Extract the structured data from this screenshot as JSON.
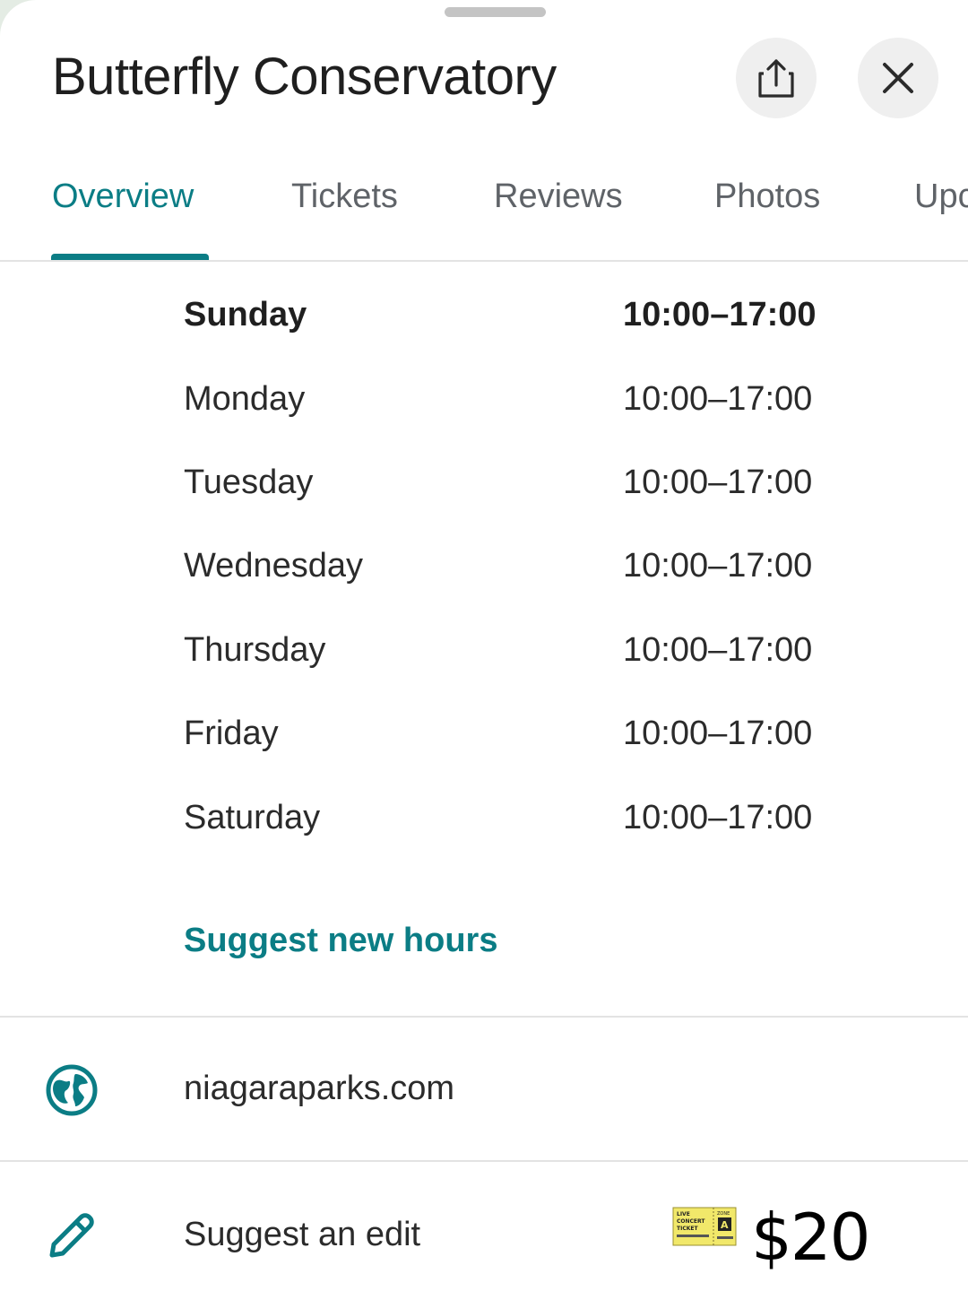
{
  "header": {
    "title": "Butterfly Conservatory",
    "share_icon": "share-icon",
    "close_icon": "close-icon"
  },
  "tabs": [
    {
      "label": "Overview",
      "active": true
    },
    {
      "label": "Tickets",
      "active": false
    },
    {
      "label": "Reviews",
      "active": false
    },
    {
      "label": "Photos",
      "active": false
    },
    {
      "label": "Upc",
      "active": false
    }
  ],
  "hours": [
    {
      "day": "Sunday",
      "time": "10:00–17:00",
      "today": true
    },
    {
      "day": "Monday",
      "time": "10:00–17:00",
      "today": false
    },
    {
      "day": "Tuesday",
      "time": "10:00–17:00",
      "today": false
    },
    {
      "day": "Wednesday",
      "time": "10:00–17:00",
      "today": false
    },
    {
      "day": "Thursday",
      "time": "10:00–17:00",
      "today": false
    },
    {
      "day": "Friday",
      "time": "10:00–17:00",
      "today": false
    },
    {
      "day": "Saturday",
      "time": "10:00–17:00",
      "today": false
    }
  ],
  "suggest_hours_label": "Suggest new hours",
  "website": {
    "icon": "globe-icon",
    "text": "niagaraparks.com"
  },
  "edit": {
    "icon": "pencil-icon",
    "text": "Suggest an edit"
  },
  "ticket_overlay": {
    "image_text": [
      "LIVE",
      "CONCERT",
      "TICKET",
      "ZONE",
      "A"
    ],
    "price": "$20"
  },
  "colors": {
    "accent": "#0b7d85",
    "text": "#1f1f1f",
    "muted_tab": "#5f6368",
    "button_bg": "#efefef"
  }
}
